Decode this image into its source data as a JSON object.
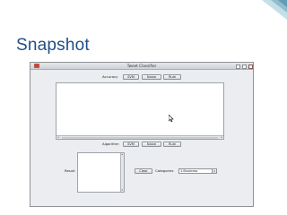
{
  "slide": {
    "title": "Snapshot"
  },
  "window": {
    "title": "Tweet Classifier"
  },
  "accuracy": {
    "label": "Accuracy",
    "buttons": [
      "SVM",
      "Naive",
      "Rule"
    ]
  },
  "algorithm": {
    "label": "Algorithm",
    "buttons": [
      "SVM",
      "Naive",
      "Rule"
    ]
  },
  "result": {
    "label": "Result",
    "clear_label": "Clear",
    "categories_label": "Categories",
    "category_selected": "1.Business"
  },
  "colors": {
    "title_text": "#1f4f84",
    "window_bg": "#ecedf0",
    "corner_accent": "#8bbfd0"
  },
  "icons": [
    "app-icon",
    "minimize-icon",
    "maximize-icon",
    "close-icon",
    "mouse-cursor-icon",
    "chevron-down-icon"
  ]
}
